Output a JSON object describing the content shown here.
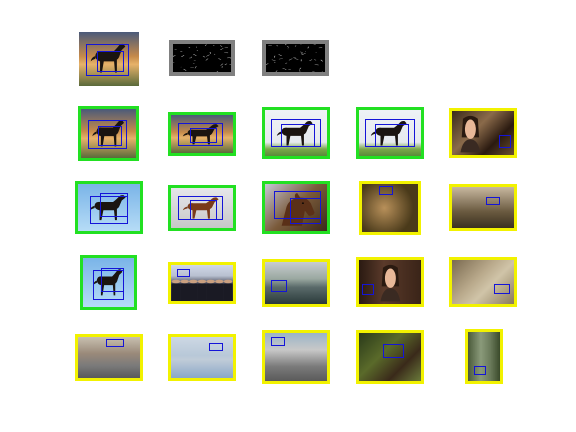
{
  "legend": {
    "correct_color": "#22e022",
    "incorrect_color": "#f2f200",
    "query_color": "#808080",
    "box_color": "#1414d8"
  },
  "query_row": [
    {
      "kind": "query-horse-sunset",
      "frame": "none"
    },
    {
      "kind": "sketch-a",
      "frame": "query"
    },
    {
      "kind": "sketch-b",
      "frame": "query"
    }
  ],
  "results": [
    {
      "kind": "horse-sunset",
      "frame": "correct"
    },
    {
      "kind": "horse-sunset",
      "frame": "correct"
    },
    {
      "kind": "horse-field",
      "frame": "correct"
    },
    {
      "kind": "horse-field",
      "frame": "correct"
    },
    {
      "kind": "woman-bar",
      "frame": "incorrect"
    },
    {
      "kind": "horse-sky",
      "frame": "correct"
    },
    {
      "kind": "horse-brown",
      "frame": "correct"
    },
    {
      "kind": "horse-head",
      "frame": "correct"
    },
    {
      "kind": "bird",
      "frame": "incorrect"
    },
    {
      "kind": "room",
      "frame": "incorrect"
    },
    {
      "kind": "horse-sky",
      "frame": "correct"
    },
    {
      "kind": "crowd",
      "frame": "incorrect"
    },
    {
      "kind": "harbor",
      "frame": "incorrect"
    },
    {
      "kind": "woman-smile",
      "frame": "incorrect"
    },
    {
      "kind": "blur",
      "frame": "incorrect"
    },
    {
      "kind": "street",
      "frame": "incorrect"
    },
    {
      "kind": "water-city",
      "frame": "incorrect"
    },
    {
      "kind": "traffic",
      "frame": "incorrect"
    },
    {
      "kind": "jungle",
      "frame": "incorrect"
    },
    {
      "kind": "forest",
      "frame": "incorrect"
    }
  ]
}
